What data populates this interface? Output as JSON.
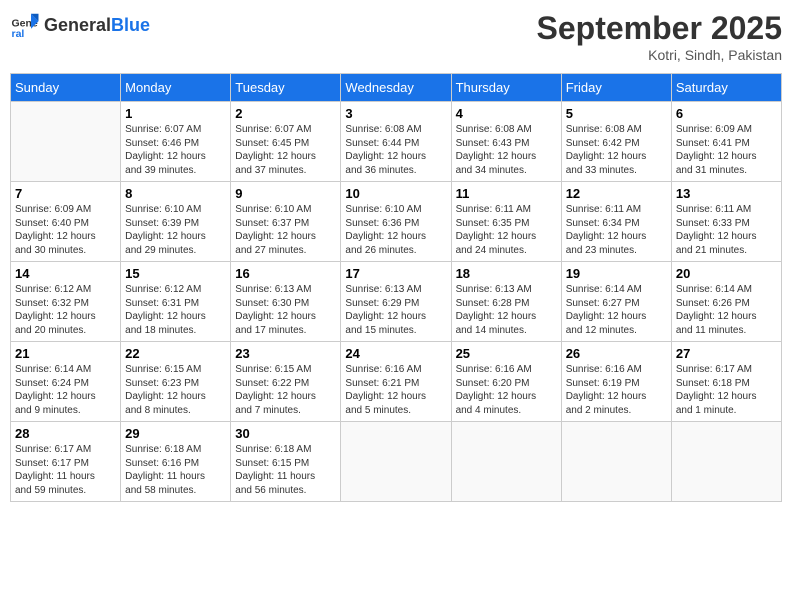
{
  "header": {
    "logo_general": "General",
    "logo_blue": "Blue",
    "month_year": "September 2025",
    "location": "Kotri, Sindh, Pakistan"
  },
  "days_of_week": [
    "Sunday",
    "Monday",
    "Tuesday",
    "Wednesday",
    "Thursday",
    "Friday",
    "Saturday"
  ],
  "weeks": [
    [
      {
        "day": "",
        "detail": ""
      },
      {
        "day": "1",
        "detail": "Sunrise: 6:07 AM\nSunset: 6:46 PM\nDaylight: 12 hours\nand 39 minutes."
      },
      {
        "day": "2",
        "detail": "Sunrise: 6:07 AM\nSunset: 6:45 PM\nDaylight: 12 hours\nand 37 minutes."
      },
      {
        "day": "3",
        "detail": "Sunrise: 6:08 AM\nSunset: 6:44 PM\nDaylight: 12 hours\nand 36 minutes."
      },
      {
        "day": "4",
        "detail": "Sunrise: 6:08 AM\nSunset: 6:43 PM\nDaylight: 12 hours\nand 34 minutes."
      },
      {
        "day": "5",
        "detail": "Sunrise: 6:08 AM\nSunset: 6:42 PM\nDaylight: 12 hours\nand 33 minutes."
      },
      {
        "day": "6",
        "detail": "Sunrise: 6:09 AM\nSunset: 6:41 PM\nDaylight: 12 hours\nand 31 minutes."
      }
    ],
    [
      {
        "day": "7",
        "detail": "Sunrise: 6:09 AM\nSunset: 6:40 PM\nDaylight: 12 hours\nand 30 minutes."
      },
      {
        "day": "8",
        "detail": "Sunrise: 6:10 AM\nSunset: 6:39 PM\nDaylight: 12 hours\nand 29 minutes."
      },
      {
        "day": "9",
        "detail": "Sunrise: 6:10 AM\nSunset: 6:37 PM\nDaylight: 12 hours\nand 27 minutes."
      },
      {
        "day": "10",
        "detail": "Sunrise: 6:10 AM\nSunset: 6:36 PM\nDaylight: 12 hours\nand 26 minutes."
      },
      {
        "day": "11",
        "detail": "Sunrise: 6:11 AM\nSunset: 6:35 PM\nDaylight: 12 hours\nand 24 minutes."
      },
      {
        "day": "12",
        "detail": "Sunrise: 6:11 AM\nSunset: 6:34 PM\nDaylight: 12 hours\nand 23 minutes."
      },
      {
        "day": "13",
        "detail": "Sunrise: 6:11 AM\nSunset: 6:33 PM\nDaylight: 12 hours\nand 21 minutes."
      }
    ],
    [
      {
        "day": "14",
        "detail": "Sunrise: 6:12 AM\nSunset: 6:32 PM\nDaylight: 12 hours\nand 20 minutes."
      },
      {
        "day": "15",
        "detail": "Sunrise: 6:12 AM\nSunset: 6:31 PM\nDaylight: 12 hours\nand 18 minutes."
      },
      {
        "day": "16",
        "detail": "Sunrise: 6:13 AM\nSunset: 6:30 PM\nDaylight: 12 hours\nand 17 minutes."
      },
      {
        "day": "17",
        "detail": "Sunrise: 6:13 AM\nSunset: 6:29 PM\nDaylight: 12 hours\nand 15 minutes."
      },
      {
        "day": "18",
        "detail": "Sunrise: 6:13 AM\nSunset: 6:28 PM\nDaylight: 12 hours\nand 14 minutes."
      },
      {
        "day": "19",
        "detail": "Sunrise: 6:14 AM\nSunset: 6:27 PM\nDaylight: 12 hours\nand 12 minutes."
      },
      {
        "day": "20",
        "detail": "Sunrise: 6:14 AM\nSunset: 6:26 PM\nDaylight: 12 hours\nand 11 minutes."
      }
    ],
    [
      {
        "day": "21",
        "detail": "Sunrise: 6:14 AM\nSunset: 6:24 PM\nDaylight: 12 hours\nand 9 minutes."
      },
      {
        "day": "22",
        "detail": "Sunrise: 6:15 AM\nSunset: 6:23 PM\nDaylight: 12 hours\nand 8 minutes."
      },
      {
        "day": "23",
        "detail": "Sunrise: 6:15 AM\nSunset: 6:22 PM\nDaylight: 12 hours\nand 7 minutes."
      },
      {
        "day": "24",
        "detail": "Sunrise: 6:16 AM\nSunset: 6:21 PM\nDaylight: 12 hours\nand 5 minutes."
      },
      {
        "day": "25",
        "detail": "Sunrise: 6:16 AM\nSunset: 6:20 PM\nDaylight: 12 hours\nand 4 minutes."
      },
      {
        "day": "26",
        "detail": "Sunrise: 6:16 AM\nSunset: 6:19 PM\nDaylight: 12 hours\nand 2 minutes."
      },
      {
        "day": "27",
        "detail": "Sunrise: 6:17 AM\nSunset: 6:18 PM\nDaylight: 12 hours\nand 1 minute."
      }
    ],
    [
      {
        "day": "28",
        "detail": "Sunrise: 6:17 AM\nSunset: 6:17 PM\nDaylight: 11 hours\nand 59 minutes."
      },
      {
        "day": "29",
        "detail": "Sunrise: 6:18 AM\nSunset: 6:16 PM\nDaylight: 11 hours\nand 58 minutes."
      },
      {
        "day": "30",
        "detail": "Sunrise: 6:18 AM\nSunset: 6:15 PM\nDaylight: 11 hours\nand 56 minutes."
      },
      {
        "day": "",
        "detail": ""
      },
      {
        "day": "",
        "detail": ""
      },
      {
        "day": "",
        "detail": ""
      },
      {
        "day": "",
        "detail": ""
      }
    ]
  ]
}
